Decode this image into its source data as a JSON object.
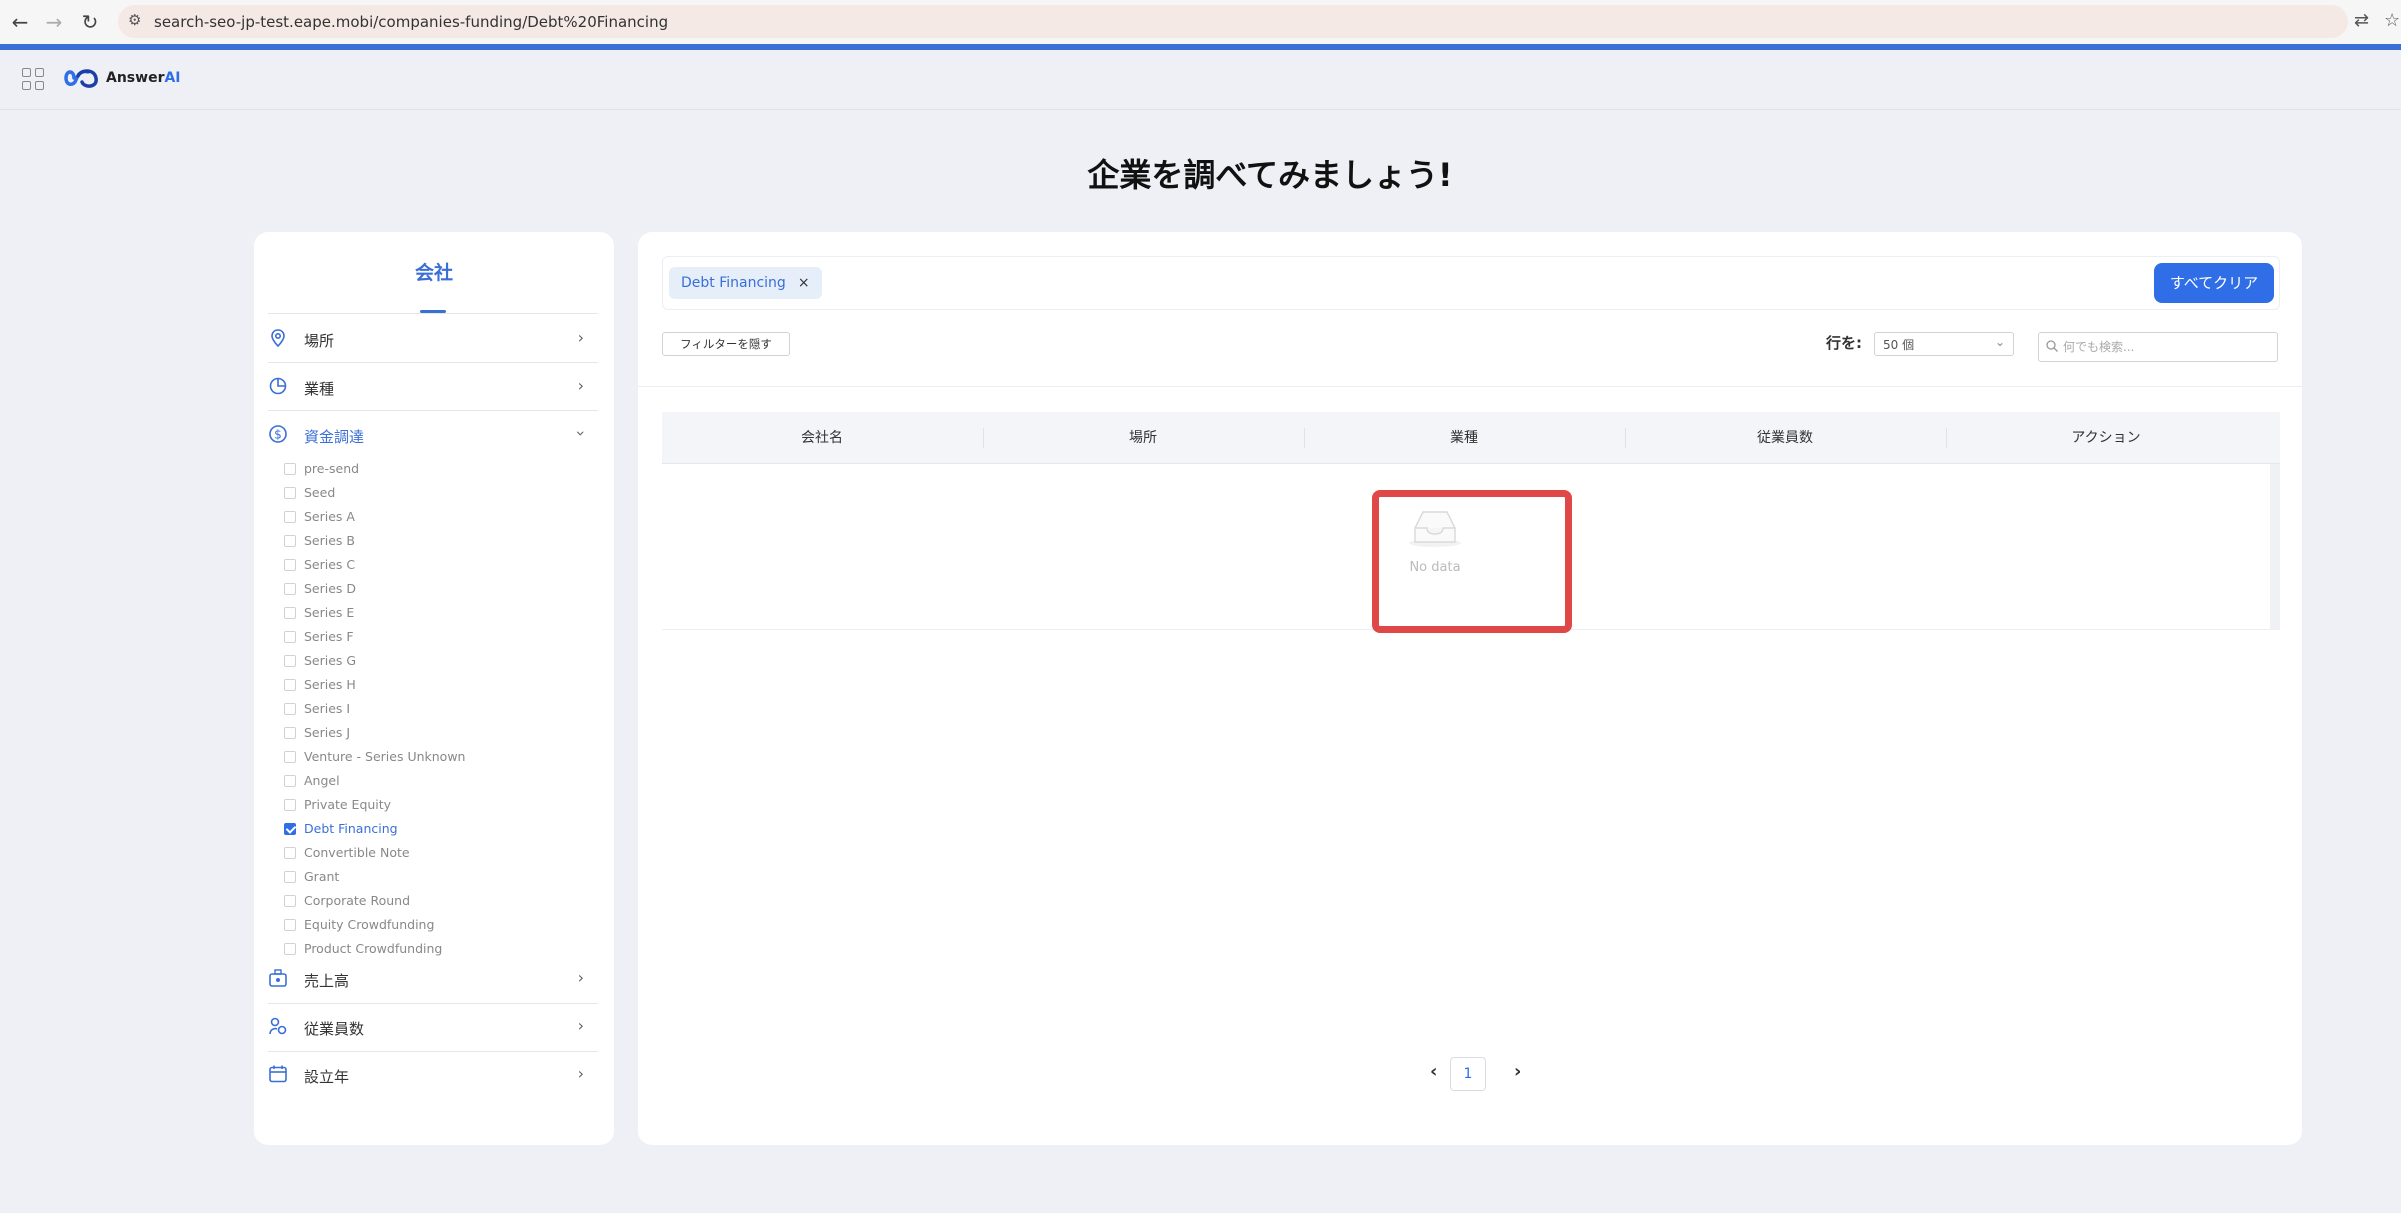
{
  "browser": {
    "url": "search-seo-jp-test.eape.mobi/companies-funding/Debt%20Financing"
  },
  "header": {
    "logo_text": "Answer",
    "logo_suffix": "AI"
  },
  "page": {
    "title": "企業を調べてみましょう!"
  },
  "sidebar": {
    "title": "会社",
    "categories": [
      {
        "label": "場所",
        "icon": "location-pin-icon"
      },
      {
        "label": "業種",
        "icon": "pie-chart-icon"
      },
      {
        "label": "資金調達",
        "icon": "dollar-circle-icon",
        "expanded": true
      },
      {
        "label": "売上高",
        "icon": "cash-register-icon"
      },
      {
        "label": "従業員数",
        "icon": "people-icon"
      },
      {
        "label": "設立年",
        "icon": "calendar-icon"
      }
    ],
    "funding_options": [
      {
        "label": "pre-send",
        "checked": false
      },
      {
        "label": "Seed",
        "checked": false
      },
      {
        "label": "Series A",
        "checked": false
      },
      {
        "label": "Series B",
        "checked": false
      },
      {
        "label": "Series C",
        "checked": false
      },
      {
        "label": "Series D",
        "checked": false
      },
      {
        "label": "Series E",
        "checked": false
      },
      {
        "label": "Series F",
        "checked": false
      },
      {
        "label": "Series G",
        "checked": false
      },
      {
        "label": "Series H",
        "checked": false
      },
      {
        "label": "Series I",
        "checked": false
      },
      {
        "label": "Series J",
        "checked": false
      },
      {
        "label": "Venture - Series Unknown",
        "checked": false
      },
      {
        "label": "Angel",
        "checked": false
      },
      {
        "label": "Private Equity",
        "checked": false
      },
      {
        "label": "Debt Financing",
        "checked": true
      },
      {
        "label": "Convertible Note",
        "checked": false
      },
      {
        "label": "Grant",
        "checked": false
      },
      {
        "label": "Corporate Round",
        "checked": false
      },
      {
        "label": "Equity Crowdfunding",
        "checked": false
      },
      {
        "label": "Product Crowdfunding",
        "checked": false
      }
    ]
  },
  "main": {
    "active_tag": "Debt Financing",
    "tag_close": "×",
    "clear_all": "すべてクリア",
    "hide_filters": "フィルターを隠す",
    "rows_label": "行を:",
    "rows_value": "50 個",
    "search_placeholder": "何でも検索...",
    "columns": [
      "会社名",
      "場所",
      "業種",
      "従業員数",
      "アクション"
    ],
    "empty_text": "No data",
    "current_page": "1"
  },
  "colors": {
    "accent": "#2f6ee6",
    "highlight": "#e04848"
  }
}
